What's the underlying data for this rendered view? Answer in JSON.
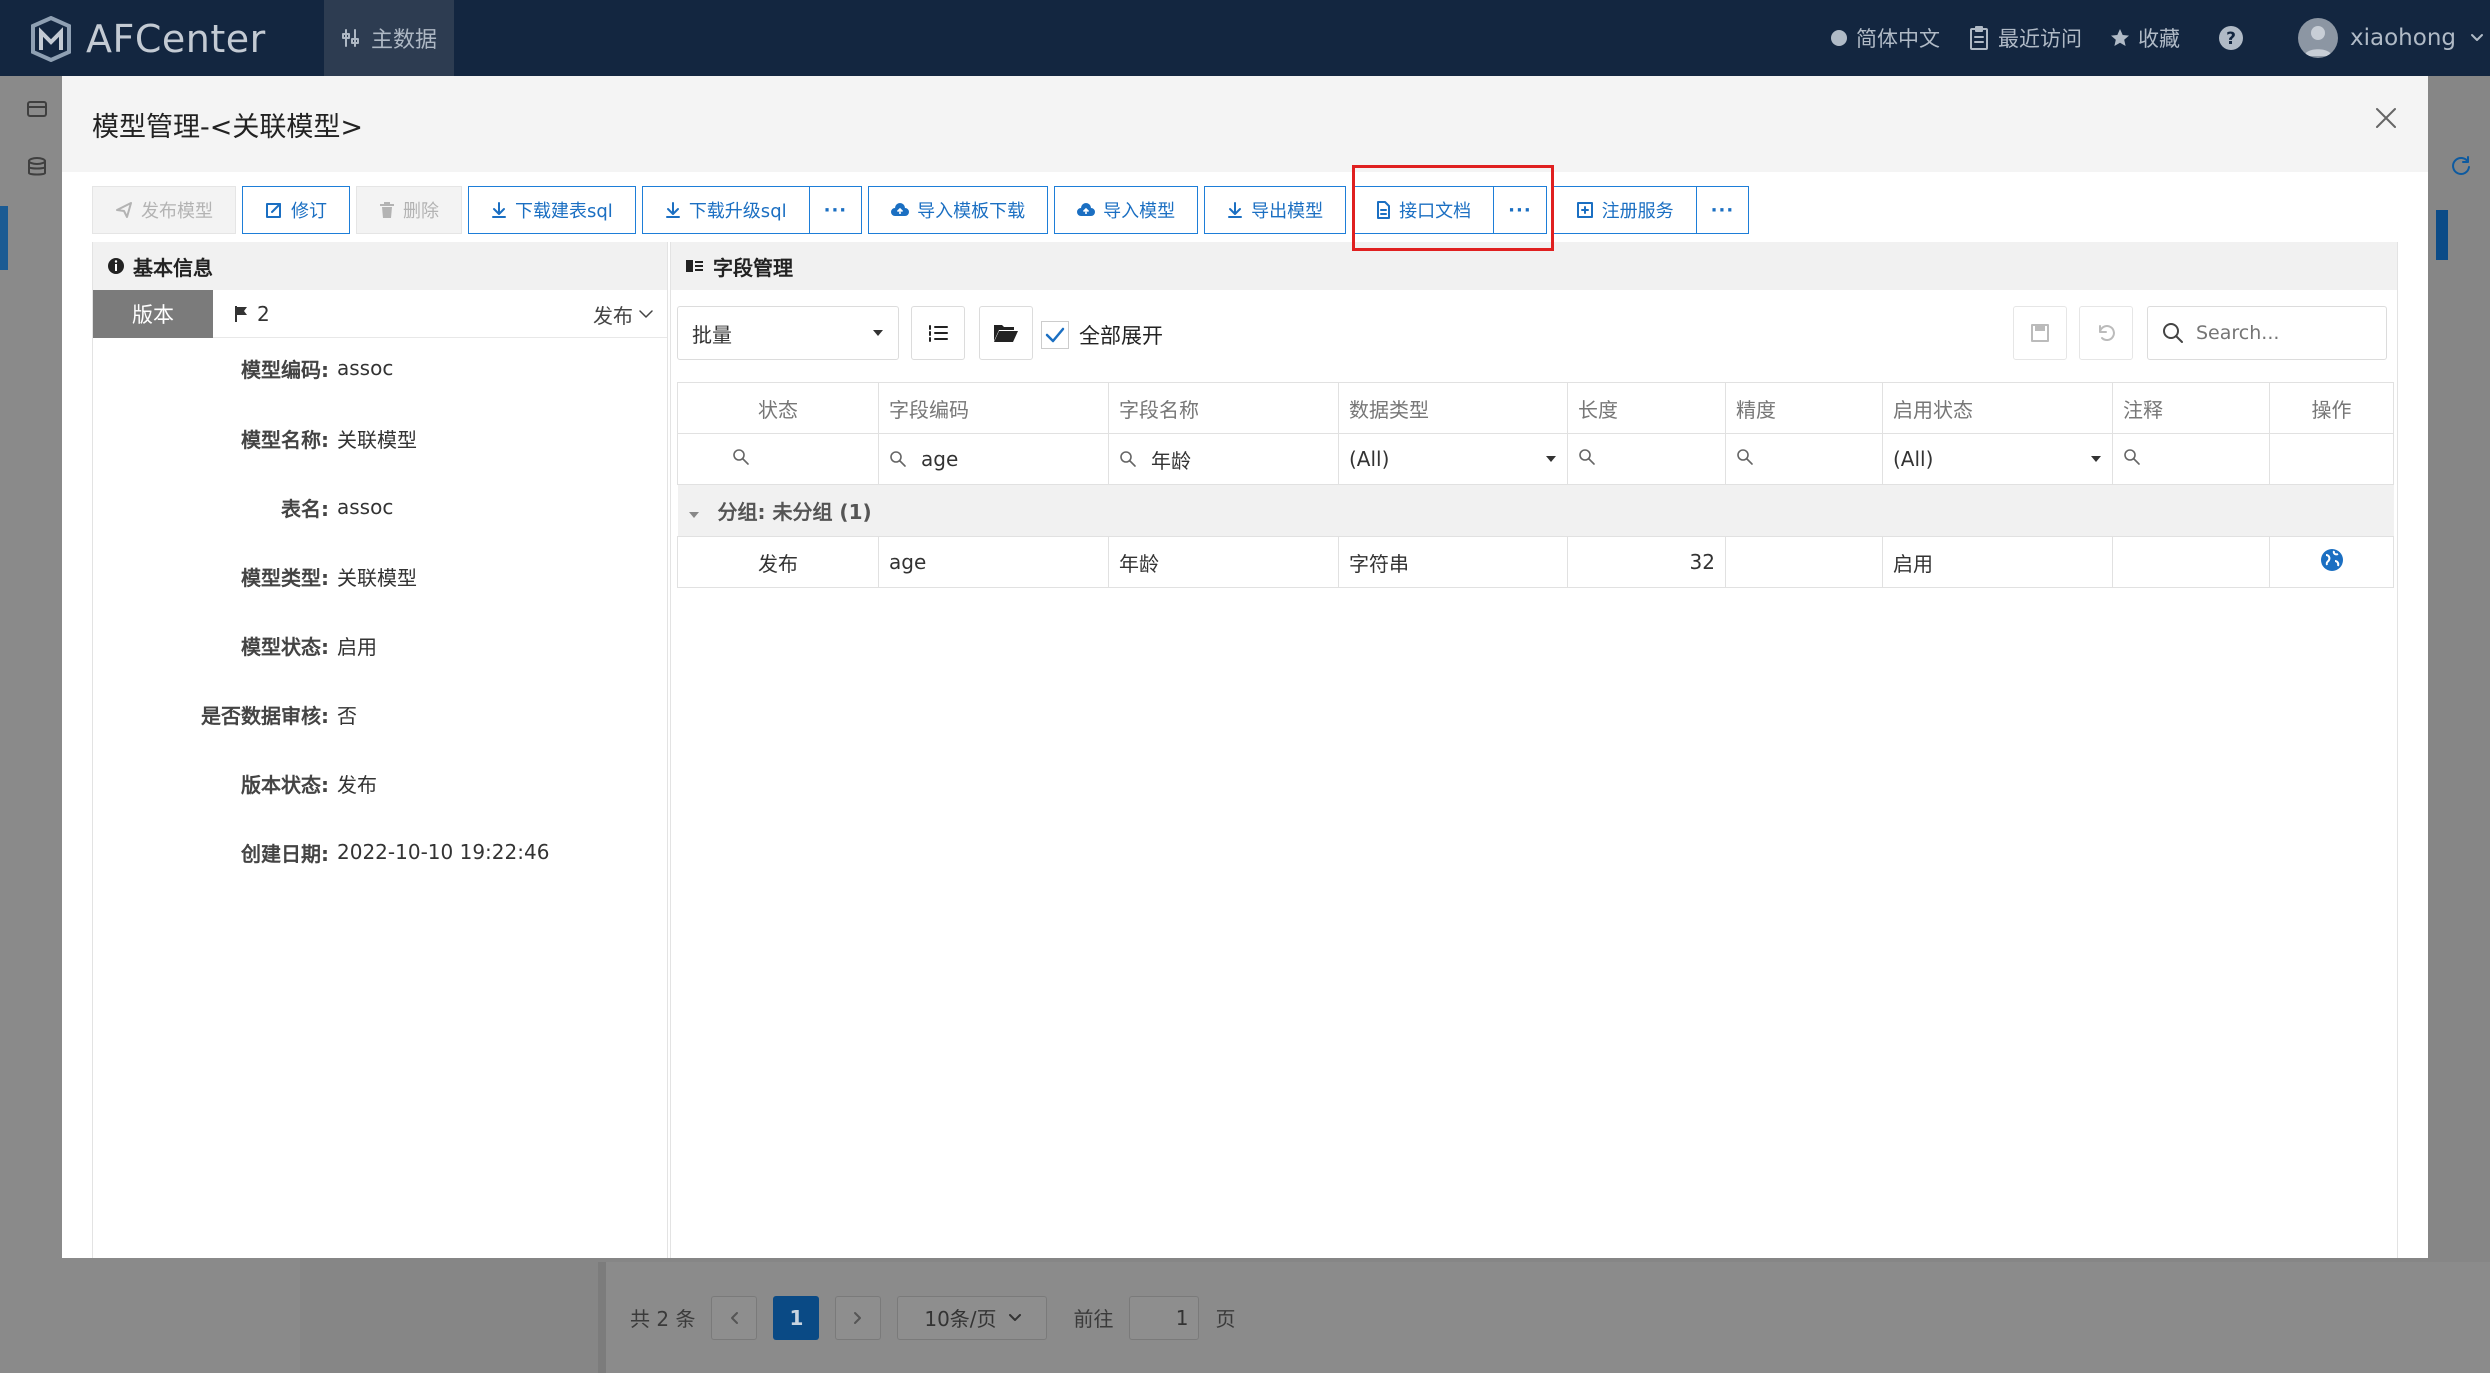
{
  "app": {
    "brand": "AFCenter",
    "nav_main": "主数据"
  },
  "topbar": {
    "language": "简体中文",
    "recent": "最近访问",
    "favorites": "收藏",
    "username": "xiaohong"
  },
  "modal": {
    "title": "模型管理-<关联模型>"
  },
  "toolbar": {
    "publish": "发布模型",
    "revise": "修订",
    "delete": "删除",
    "download_create_sql": "下载建表sql",
    "download_upgrade_sql": "下载升级sql",
    "import_template": "导入模板下载",
    "import_model": "导入模型",
    "export_model": "导出模型",
    "api_doc": "接口文档",
    "register_service": "注册服务"
  },
  "basic_info": {
    "title": "基本信息",
    "version_tab": "版本",
    "version_number": "2",
    "version_status_select": "发布",
    "fields": [
      {
        "label": "模型编码:",
        "value": "assoc"
      },
      {
        "label": "模型名称:",
        "value": "关联模型"
      },
      {
        "label": "表名:",
        "value": "assoc"
      },
      {
        "label": "模型类型:",
        "value": "关联模型"
      },
      {
        "label": "模型状态:",
        "value": "启用"
      },
      {
        "label": "是否数据审核:",
        "value": "否"
      },
      {
        "label": "版本状态:",
        "value": "发布"
      },
      {
        "label": "创建日期:",
        "value": "2022-10-10 19:22:46"
      }
    ]
  },
  "field_mgmt": {
    "title": "字段管理",
    "batch_select": "批量",
    "expand_all": "全部展开",
    "search_placeholder": "Search...",
    "columns": [
      "状态",
      "字段编码",
      "字段名称",
      "数据类型",
      "长度",
      "精度",
      "启用状态",
      "注释",
      "操作"
    ],
    "filters": {
      "code": "age",
      "name": "年龄",
      "type": "(All)",
      "enabled": "(All)"
    },
    "group_label": "分组: 未分组 (1)",
    "rows": [
      {
        "status": "发布",
        "code": "age",
        "name": "年龄",
        "type": "字符串",
        "length": "32",
        "precision": "",
        "enabled": "启用",
        "comment": ""
      }
    ]
  },
  "pager": {
    "total": "共 2 条",
    "current": "1",
    "page_size": "10条/页",
    "goto_label": "前往",
    "goto_value": "1",
    "page_suffix": "页"
  }
}
